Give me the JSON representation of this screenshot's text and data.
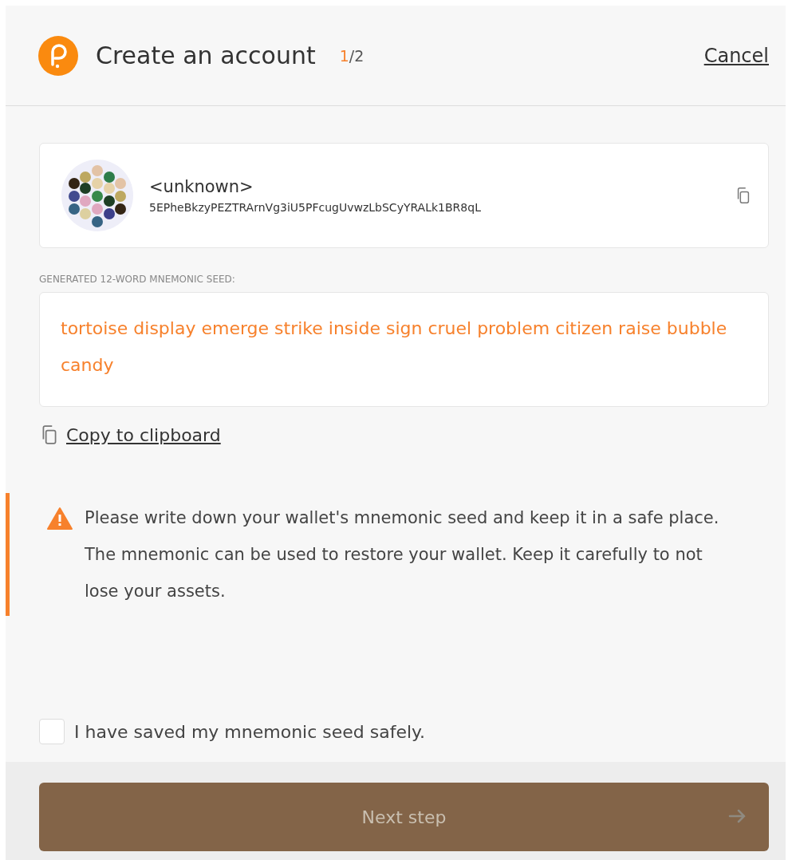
{
  "header": {
    "title": "Create an account",
    "step_current": "1",
    "step_total": "/2",
    "cancel": "Cancel"
  },
  "account": {
    "name": "<unknown>",
    "address": "5EPheBkzyPEZTRArnVg3iU5PFcugUvwzLbSCyYRALk1BR8qL"
  },
  "seed": {
    "label": "GENERATED 12-WORD MNEMONIC SEED:",
    "words": "tortoise display emerge strike inside sign cruel problem citizen raise bubble candy"
  },
  "copy_link": "Copy to clipboard",
  "warning": "Please write down your wallet's mnemonic seed and keep it in a safe place. The mnemonic can be used to restore your wallet. Keep it carefully to not lose your assets.",
  "confirm": {
    "label": "I have saved my mnemonic seed safely.",
    "checked": false
  },
  "next_button": {
    "label": "Next step",
    "disabled": true
  }
}
